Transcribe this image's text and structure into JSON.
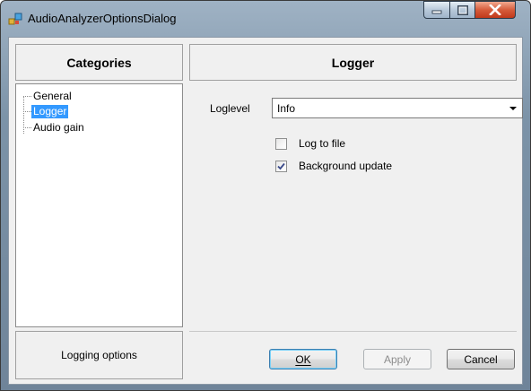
{
  "window": {
    "title": "AudioAnalyzerOptionsDialog",
    "icon": "app-icon",
    "controls": [
      "minimize-icon",
      "maximize-icon",
      "close-icon"
    ]
  },
  "categories": {
    "header": "Categories",
    "items": [
      {
        "label": "General",
        "selected": false
      },
      {
        "label": "Logger",
        "selected": true
      },
      {
        "label": "Audio gain",
        "selected": false
      }
    ],
    "description": "Logging options"
  },
  "panel": {
    "header": "Logger",
    "loglevel_label": "Loglevel",
    "loglevel_value": "Info",
    "checkboxes": [
      {
        "label": "Log to file",
        "checked": false
      },
      {
        "label": "Background update",
        "checked": true
      }
    ]
  },
  "buttons": {
    "ok": "OK",
    "apply": "Apply",
    "cancel": "Cancel"
  },
  "colors": {
    "selection": "#3399ff",
    "close_button": "#c0391b",
    "client_bg": "#f0f0f0"
  }
}
